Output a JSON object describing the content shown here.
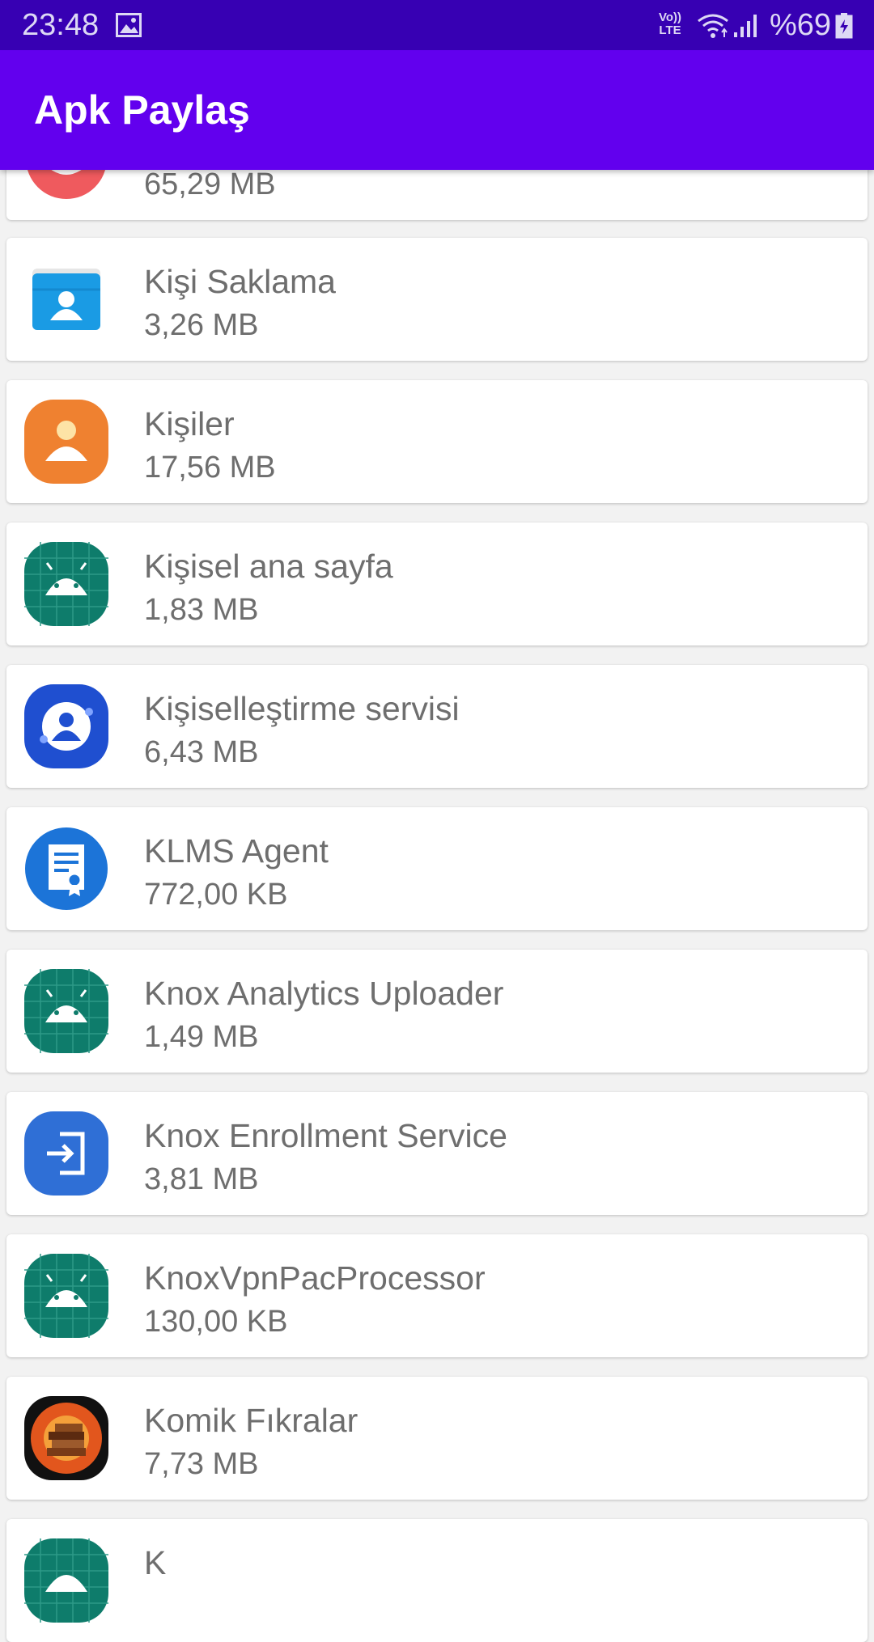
{
  "status_bar": {
    "time": "23:48",
    "volte": "Vo)) LTE",
    "battery": "%69",
    "icons": [
      "gallery-icon",
      "volte-icon",
      "wifi-icon",
      "signal-icon",
      "battery-charging-icon"
    ]
  },
  "app_bar": {
    "title": "Apk Paylaş"
  },
  "apps": [
    {
      "name": "",
      "size": "65,29 MB",
      "icon": "red-app-icon"
    },
    {
      "name": "Kişi Saklama",
      "size": "3,26 MB",
      "icon": "contact-storage-icon"
    },
    {
      "name": "Kişiler",
      "size": "17,56 MB",
      "icon": "contacts-icon"
    },
    {
      "name": "Kişisel ana sayfa",
      "size": "1,83 MB",
      "icon": "android-icon"
    },
    {
      "name": "Kişiselleştirme servisi",
      "size": "6,43 MB",
      "icon": "personalization-icon"
    },
    {
      "name": "KLMS Agent",
      "size": "772,00 KB",
      "icon": "klms-certificate-icon"
    },
    {
      "name": "Knox Analytics Uploader",
      "size": "1,49 MB",
      "icon": "android-icon"
    },
    {
      "name": "Knox Enrollment Service",
      "size": "3,81 MB",
      "icon": "enrollment-icon"
    },
    {
      "name": "KnoxVpnPacProcessor",
      "size": "130,00 KB",
      "icon": "android-icon"
    },
    {
      "name": "Komik Fıkralar",
      "size": "7,73 MB",
      "icon": "books-icon"
    },
    {
      "name": "K",
      "size": "",
      "icon": "android-icon"
    }
  ]
}
